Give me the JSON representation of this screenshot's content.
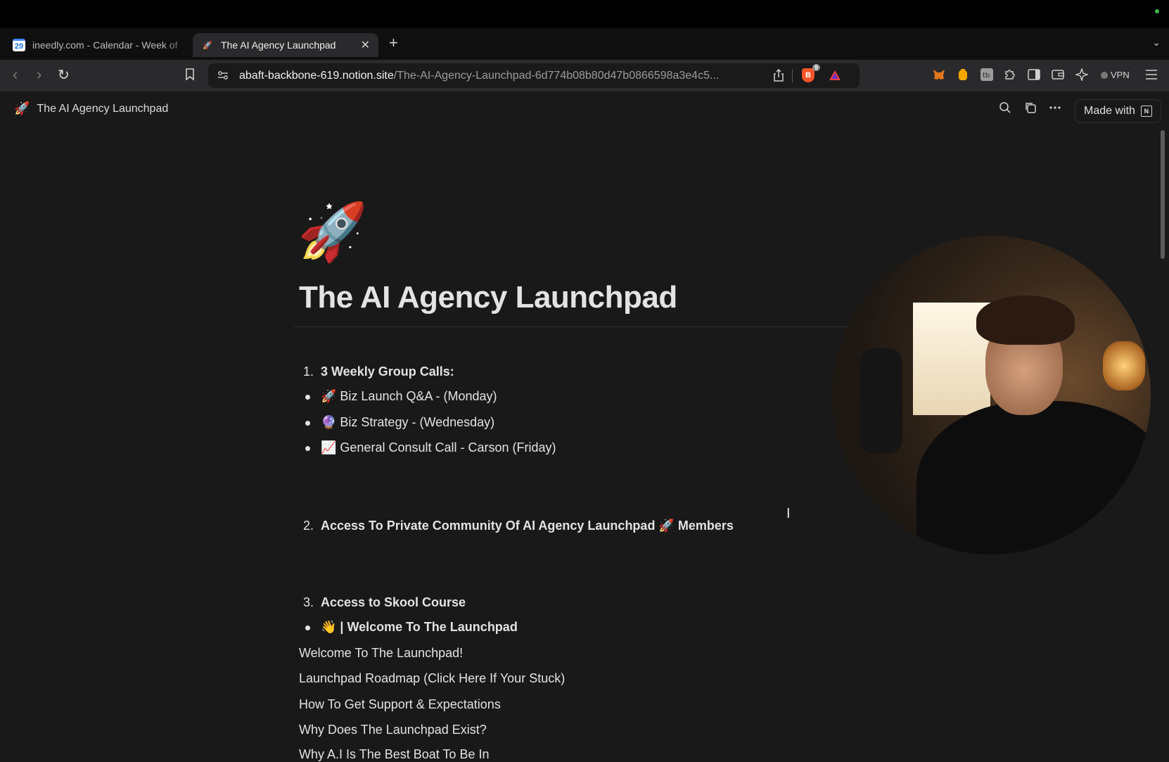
{
  "browser": {
    "tabs": [
      {
        "title": "ineedly.com - Calendar - Week of",
        "favicon": "29",
        "active": false
      },
      {
        "title": "The AI Agency Launchpad",
        "favicon": "🚀",
        "active": true
      }
    ],
    "new_tab_symbol": "+",
    "tab_close_symbol": "✕",
    "tab_list_symbol": "⌄",
    "url_host": "abaft-backbone-619.notion.site",
    "url_path": "/The-AI-Agency-Launchpad-6d774b08b80d47b0866598a3e4c5...",
    "shields_count": "9",
    "vpn_label": "VPN",
    "status_dot_color": "#3fb950"
  },
  "notion": {
    "breadcrumb_emoji": "🚀",
    "breadcrumb_title": "The AI Agency Launchpad",
    "made_with_label": "Made with",
    "made_with_logo": "N"
  },
  "page": {
    "icon": "🚀",
    "title": "The AI Agency Launchpad",
    "section1": {
      "number": "1.",
      "heading": "3 Weekly Group Calls:",
      "items": [
        "🚀 Biz Launch Q&A - (Monday)",
        "🔮 Biz Strategy - (Wednesday)",
        "📈 General Consult Call - Carson (Friday)"
      ]
    },
    "section2": {
      "number": "2.",
      "heading": "Access To Private Community Of AI Agency Launchpad 🚀 Members"
    },
    "section3": {
      "number": "3.",
      "heading": "Access to Skool Course",
      "items": [
        "👋 | Welcome To The Launchpad"
      ]
    },
    "links": [
      "Welcome To The Launchpad!",
      "Launchpad Roadmap (Click Here If Your Stuck)",
      "How To Get Support & Expectations",
      "Why Does The Launchpad Exist?",
      "Why A.I Is The Best Boat To Be In"
    ]
  }
}
